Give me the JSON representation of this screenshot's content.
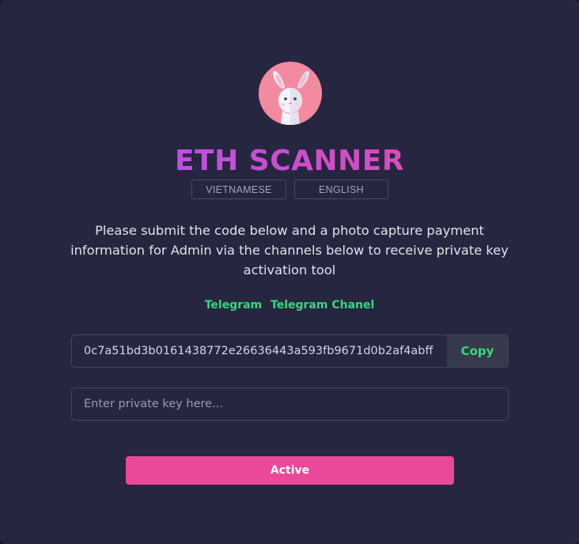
{
  "header": {
    "avatar_icon": "bunny-icon",
    "title": "ETH SCANNER",
    "languages": [
      "VIETNAMESE",
      "ENGLISH"
    ]
  },
  "instructions": "Please submit the code below and a photo capture payment information for Admin via the channels below to receive private key activation tool",
  "links": [
    "Telegram",
    "Telegram Chanel"
  ],
  "code": {
    "value": "0c7a51bd3b0161438772e26636443a593fb9671d0b2af4abff",
    "copy_label": "Copy"
  },
  "private_key": {
    "value": "",
    "placeholder": "Enter private key here..."
  },
  "active_label": "Active",
  "colors": {
    "background": "#262640",
    "accent_pink": "#ec4899",
    "accent_purple": "#a855f7",
    "link_green": "#34d97b"
  }
}
